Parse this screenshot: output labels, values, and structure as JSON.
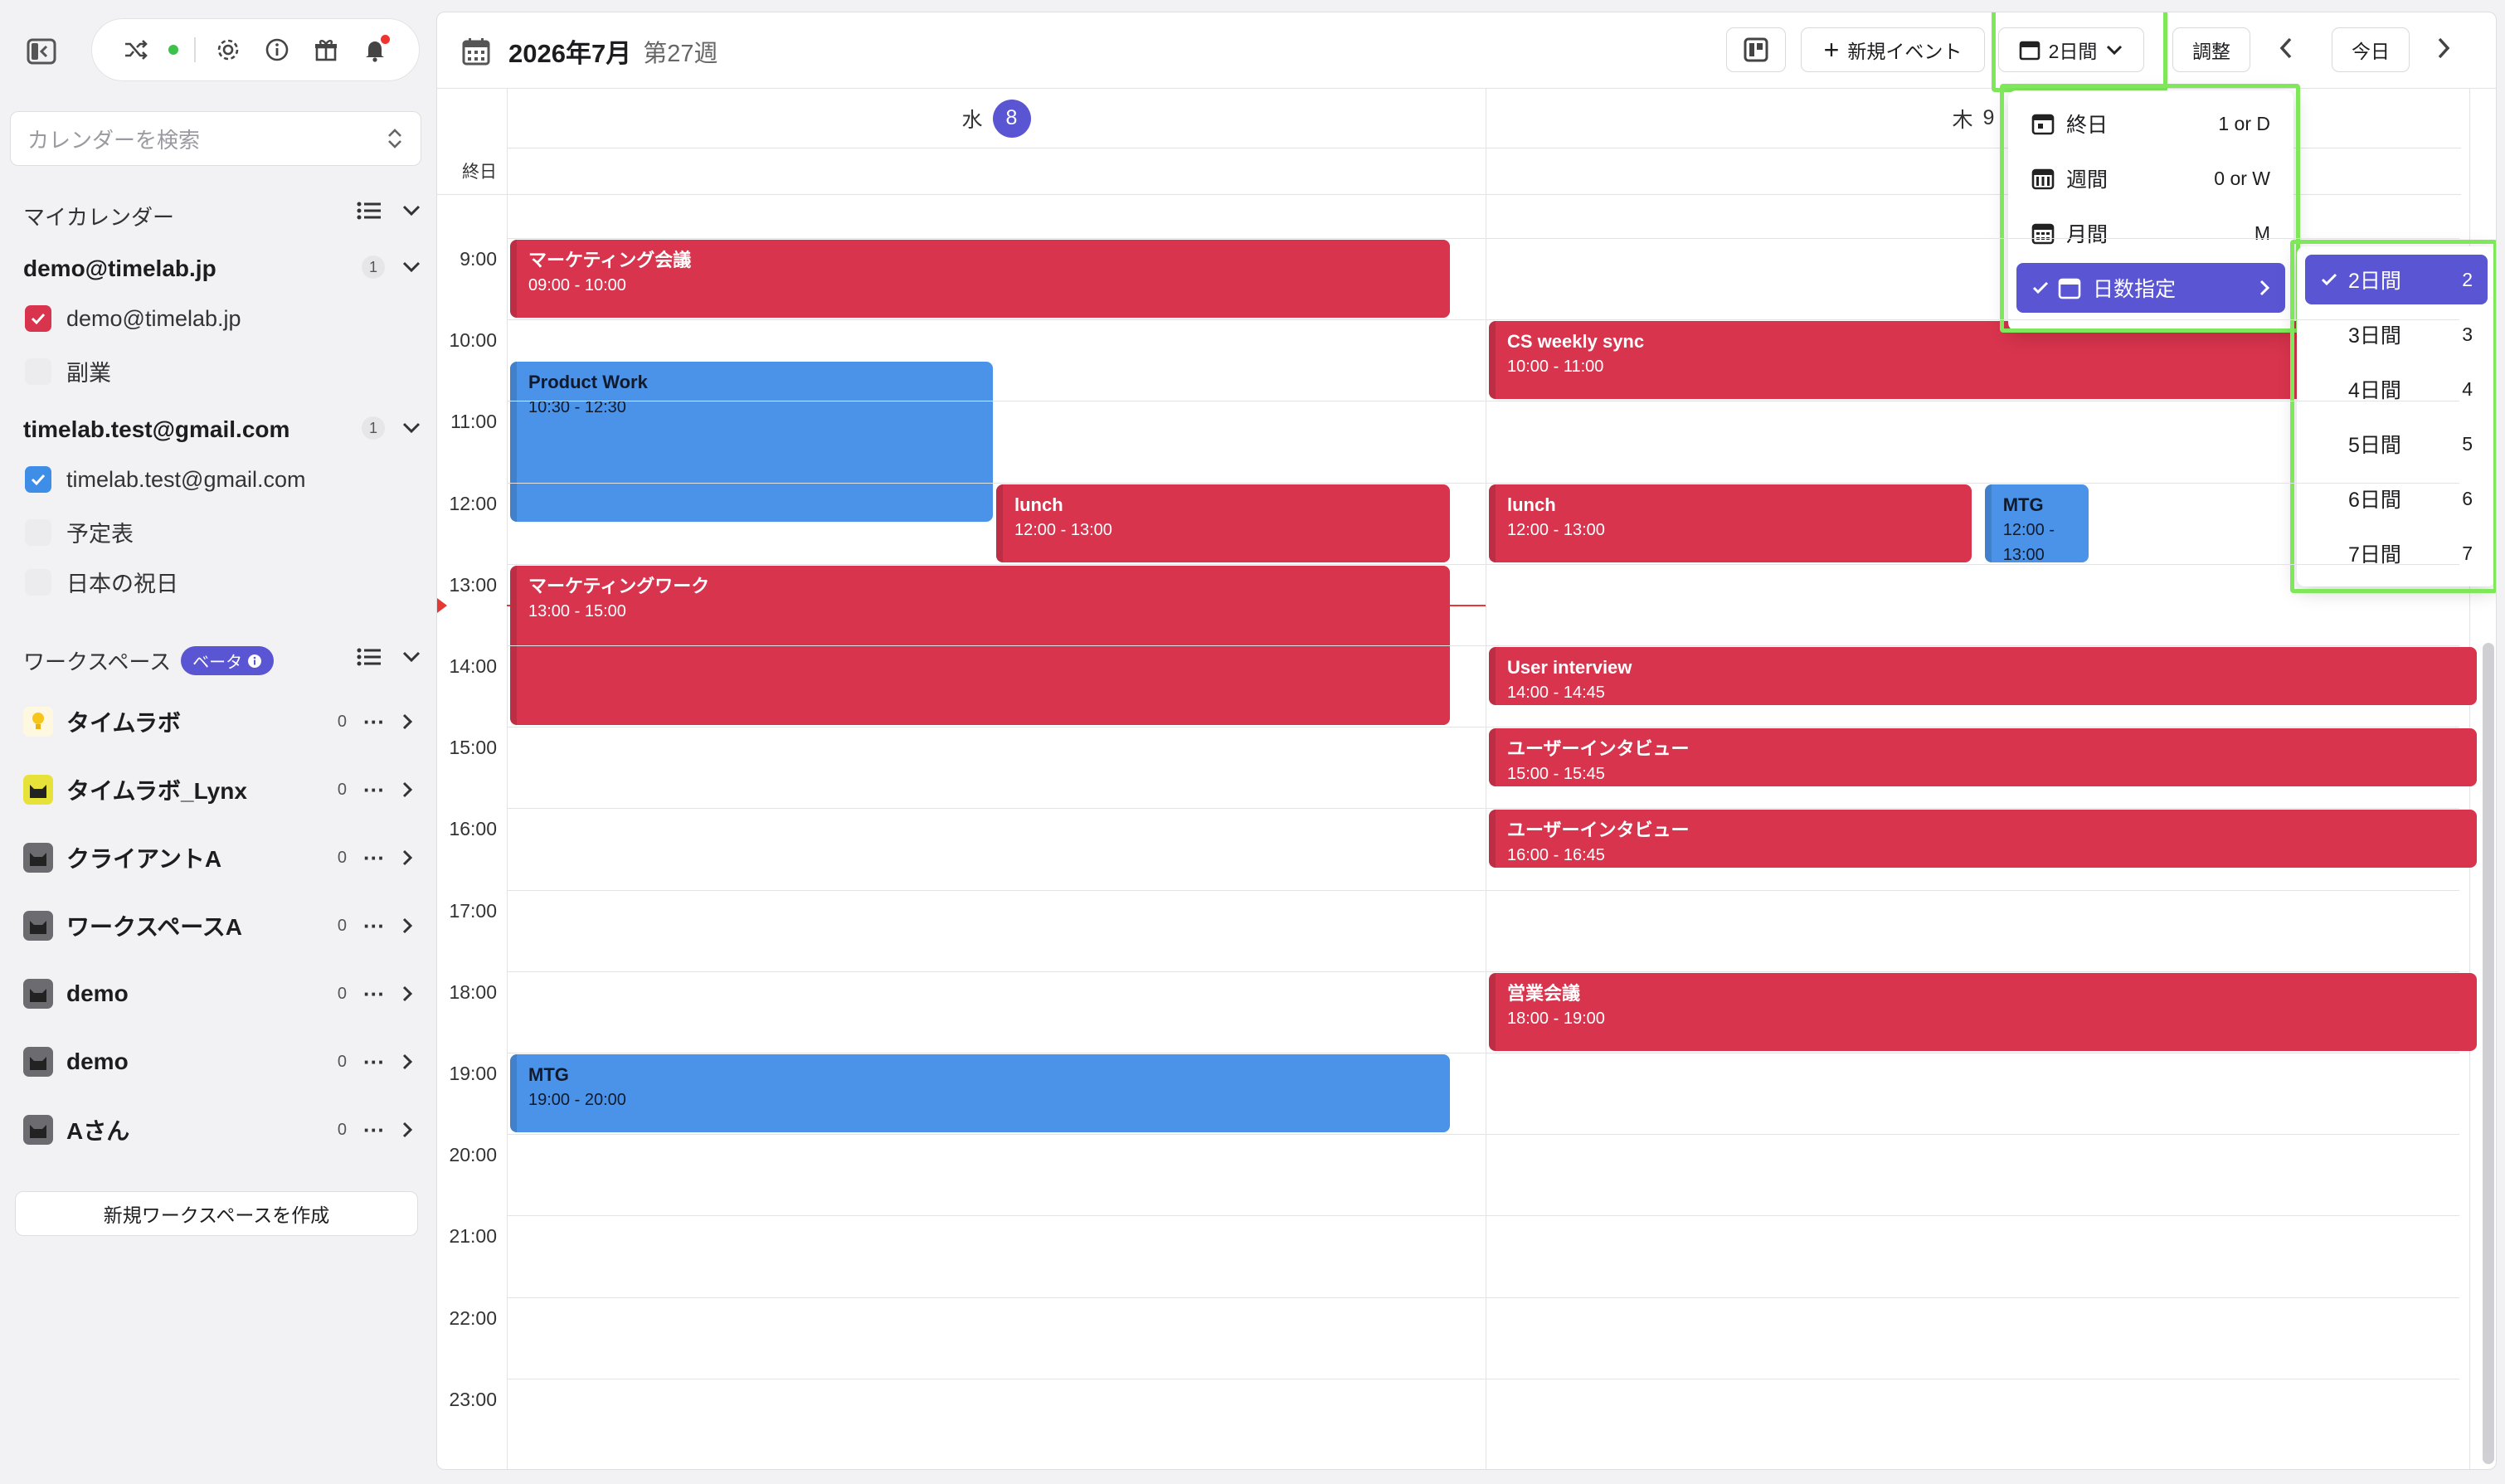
{
  "sidebar": {
    "search_placeholder": "カレンダーを検索",
    "my_calendars_label": "マイカレンダー",
    "accounts": [
      {
        "email": "demo@timelab.jp",
        "count": "1",
        "calendars": [
          "demo@timelab.jp",
          "副業"
        ]
      },
      {
        "email": "timelab.test@gmail.com",
        "count": "1",
        "calendars": [
          "timelab.test@gmail.com",
          "予定表",
          "日本の祝日"
        ]
      }
    ],
    "workspace_label": "ワークスペース",
    "beta_label": "ベータ",
    "workspaces": [
      {
        "name": "タイムラボ",
        "count": "0"
      },
      {
        "name": "タイムラボ_Lynx",
        "count": "0"
      },
      {
        "name": "クライアントA",
        "count": "0"
      },
      {
        "name": "ワークスペースA",
        "count": "0"
      },
      {
        "name": "demo",
        "count": "0"
      },
      {
        "name": "demo",
        "count": "0"
      },
      {
        "name": "Aさん",
        "count": "0"
      }
    ],
    "create_workspace": "新規ワークスペースを作成"
  },
  "header": {
    "title": "2026年7月",
    "week": "第27週",
    "new_event": "新規イベント",
    "range": "2日間",
    "adjust": "調整",
    "today": "今日"
  },
  "days": [
    {
      "dow": "水",
      "num": "8"
    },
    {
      "dow": "木",
      "num": "9"
    }
  ],
  "allday_label": "終日",
  "times": [
    "9:00",
    "10:00",
    "11:00",
    "12:00",
    "13:00",
    "14:00",
    "15:00",
    "16:00",
    "17:00",
    "18:00",
    "19:00",
    "20:00",
    "21:00",
    "22:00",
    "23:00"
  ],
  "events": [
    {
      "title": "マーケティング会議",
      "time": "09:00 - 10:00",
      "color": "red"
    },
    {
      "title": "Product Work",
      "time": "10:30 - 12:30",
      "color": "blue"
    },
    {
      "title": "lunch",
      "time": "12:00 - 13:00",
      "color": "red"
    },
    {
      "title": "マーケティングワーク",
      "time": "13:00 - 15:00",
      "color": "red"
    },
    {
      "title": "MTG",
      "time": "19:00 - 20:00",
      "color": "blue"
    },
    {
      "title": "CS weekly sync",
      "time": "10:00 - 11:00",
      "color": "red"
    },
    {
      "title": "lunch",
      "time": "12:00 - 13:00",
      "color": "red"
    },
    {
      "title": "MTG",
      "time": "12:00 - 13:00",
      "color": "blue"
    },
    {
      "title": "User interview",
      "time": "14:00 - 14:45",
      "color": "red"
    },
    {
      "title": "ユーザーインタビュー",
      "time": "15:00 - 15:45",
      "color": "red"
    },
    {
      "title": "ユーザーインタビュー",
      "time": "16:00 - 16:45",
      "color": "red"
    },
    {
      "title": "営業会議",
      "time": "18:00 - 19:00",
      "color": "red"
    }
  ],
  "view_menu": [
    {
      "label": "終日",
      "key": "1 or D"
    },
    {
      "label": "週間",
      "key": "0 or W"
    },
    {
      "label": "月間",
      "key": "M"
    },
    {
      "label": "日数指定",
      "key": ""
    }
  ],
  "days_menu": [
    {
      "label": "2日間",
      "key": "2"
    },
    {
      "label": "3日間",
      "key": "3"
    },
    {
      "label": "4日間",
      "key": "4"
    },
    {
      "label": "5日間",
      "key": "5"
    },
    {
      "label": "6日間",
      "key": "6"
    },
    {
      "label": "7日間",
      "key": "7"
    }
  ],
  "colors": {
    "accent": "#5a55d3",
    "event_red": "#d8344d",
    "event_blue": "#4a93e8",
    "highlight": "#7ee85a"
  }
}
